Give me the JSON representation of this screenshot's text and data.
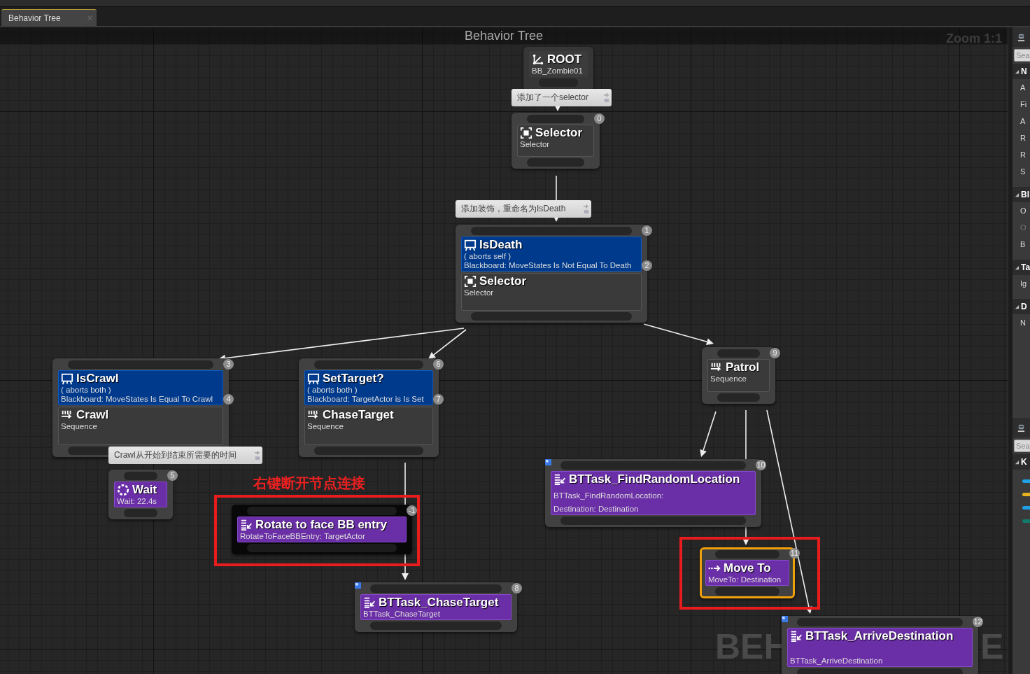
{
  "tabs": [
    {
      "label": "Behavior Tree",
      "selected": true
    }
  ],
  "graph": {
    "title": "Behavior Tree",
    "zoom": "Zoom 1:1",
    "corner_label_parts": [
      "BEH",
      "E"
    ],
    "nodes": [
      {
        "kind": "root",
        "title": "ROOT",
        "subtitle": "BB_Zombie01",
        "selected": false,
        "connected": true
      },
      {
        "kind": "composite",
        "index": "0",
        "title": "Selector",
        "subtitle": "Selector",
        "selected": false,
        "connected": true,
        "comment": "添加了一个selector"
      },
      {
        "kind": "composite",
        "index": "1",
        "decorators": [
          {
            "title": "IsDeath",
            "lines": [
              "( aborts self )",
              "Blackboard: MoveStates Is Not Equal To Death"
            ],
            "index": "2"
          }
        ],
        "title": "Selector",
        "subtitle": "Selector",
        "selected": false,
        "connected": true,
        "comment": "添加装饰，重命名为IsDeath"
      },
      {
        "kind": "composite",
        "index": "3",
        "decorators": [
          {
            "title": "IsCrawl",
            "lines": [
              "( aborts both )",
              "Blackboard: MoveStates Is Equal To Crawl"
            ],
            "index": "4"
          }
        ],
        "title": "Crawl",
        "subtitle": "Sequence",
        "selected": false,
        "connected": true
      },
      {
        "kind": "composite",
        "index": "6",
        "decorators": [
          {
            "title": "SetTarget?",
            "lines": [
              "( aborts both )",
              "Blackboard: TargetActor is Is Set"
            ],
            "index": "7"
          }
        ],
        "title": "ChaseTarget",
        "subtitle": "Sequence",
        "selected": false,
        "connected": true
      },
      {
        "kind": "composite",
        "index": "9",
        "title": "Patrol",
        "subtitle": "Sequence",
        "selected": false,
        "connected": true
      },
      {
        "kind": "task",
        "index": "5",
        "title": "Wait",
        "lines": [
          "Wait: 22.4s"
        ],
        "selected": false,
        "connected": true,
        "comment": "Crawl从开始到结束所需要的时间"
      },
      {
        "kind": "task",
        "index": "-1",
        "title": "Rotate to face BB entry",
        "lines": [
          "RotateToFaceBBEntry: TargetActor"
        ],
        "selected": false,
        "connected": false
      },
      {
        "kind": "task",
        "index": "10",
        "title": "BTTask_FindRandomLocation",
        "lines": [
          "BTTask_FindRandomLocation:",
          "Destination: Destination"
        ],
        "selected": false,
        "connected": true,
        "blueprint": true
      },
      {
        "kind": "task",
        "index": "11",
        "title": "Move To",
        "lines": [
          "MoveTo: Destination"
        ],
        "selected": true,
        "connected": true
      },
      {
        "kind": "task",
        "index": "8",
        "title": "BTTask_ChaseTarget",
        "lines": [
          "BTTask_ChaseTarget"
        ],
        "selected": false,
        "connected": true,
        "blueprint": true
      },
      {
        "kind": "task",
        "index": "12",
        "title": "BTTask_ArriveDestination",
        "lines": [
          "BTTask_ArriveDestination"
        ],
        "selected": false,
        "connected": true,
        "blueprint": true
      }
    ],
    "annotations": [
      {
        "kind": "label",
        "text": "右键断开节点连接"
      },
      {
        "kind": "box"
      },
      {
        "kind": "box"
      }
    ]
  },
  "side_panel": {
    "search": {
      "placeholder": "Sea"
    },
    "sections": [
      {
        "title": "N",
        "expanded": true,
        "rows": [
          {
            "label": "A",
            "disabled": false
          },
          {
            "label": "Fi",
            "disabled": false
          },
          {
            "label": "A",
            "disabled": false
          },
          {
            "label": "R",
            "disabled": false
          },
          {
            "label": "R",
            "disabled": false
          },
          {
            "label": "S",
            "disabled": false
          }
        ]
      },
      {
        "title": "Bl",
        "expanded": true,
        "rows": [
          {
            "label": "O",
            "disabled": false
          },
          {
            "label": "O",
            "disabled": true
          },
          {
            "label": "B",
            "disabled": false
          }
        ]
      },
      {
        "title": "Ta",
        "expanded": true,
        "rows": [
          {
            "label": "Ig",
            "disabled": false
          }
        ]
      },
      {
        "title": "D",
        "expanded": true,
        "rows": [
          {
            "label": "N",
            "disabled": false
          }
        ]
      }
    ]
  },
  "keys_panel": {
    "search": {
      "placeholder": "Sea"
    },
    "section": {
      "title": "K",
      "expanded": true
    },
    "keys": [
      {
        "color": "#1ea0e6"
      },
      {
        "color": "#e6b41e"
      },
      {
        "color": "#1ea0e6"
      },
      {
        "color": "#137a6c"
      }
    ]
  }
}
